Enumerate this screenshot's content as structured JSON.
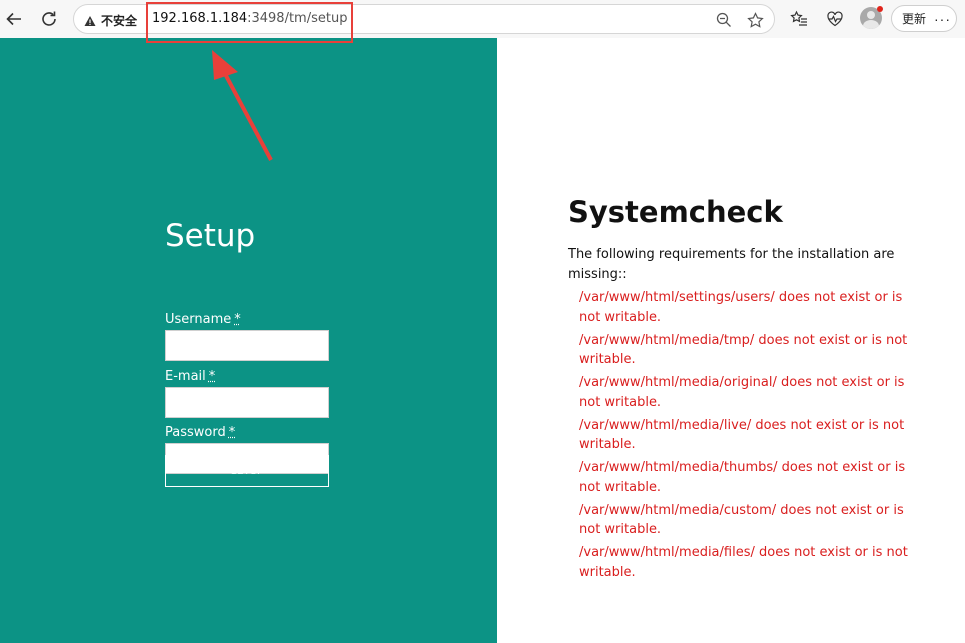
{
  "browser": {
    "security_label": "不安全",
    "url_host": "192.168.1.184",
    "url_path": ":3498/tm/setup",
    "update_label": "更新",
    "highlight_color": "#e8403a"
  },
  "setup": {
    "title": "Setup",
    "username_label": "Username",
    "email_label": "E-mail",
    "password_label": "Password",
    "required_mark": "*",
    "button_label": "SETUP",
    "panel_color": "#0c9385"
  },
  "systemcheck": {
    "title": "Systemcheck",
    "description": "The following requirements for the installation are missing::",
    "errors": [
      "/var/www/html/settings/users/ does not exist or is not writable.",
      "/var/www/html/media/tmp/ does not exist or is not writable.",
      "/var/www/html/media/original/ does not exist or is not writable.",
      "/var/www/html/media/live/ does not exist or is not writable.",
      "/var/www/html/media/thumbs/ does not exist or is not writable.",
      "/var/www/html/media/custom/ does not exist or is not writable.",
      "/var/www/html/media/files/ does not exist or is not writable."
    ],
    "error_color": "#d91e1e"
  }
}
